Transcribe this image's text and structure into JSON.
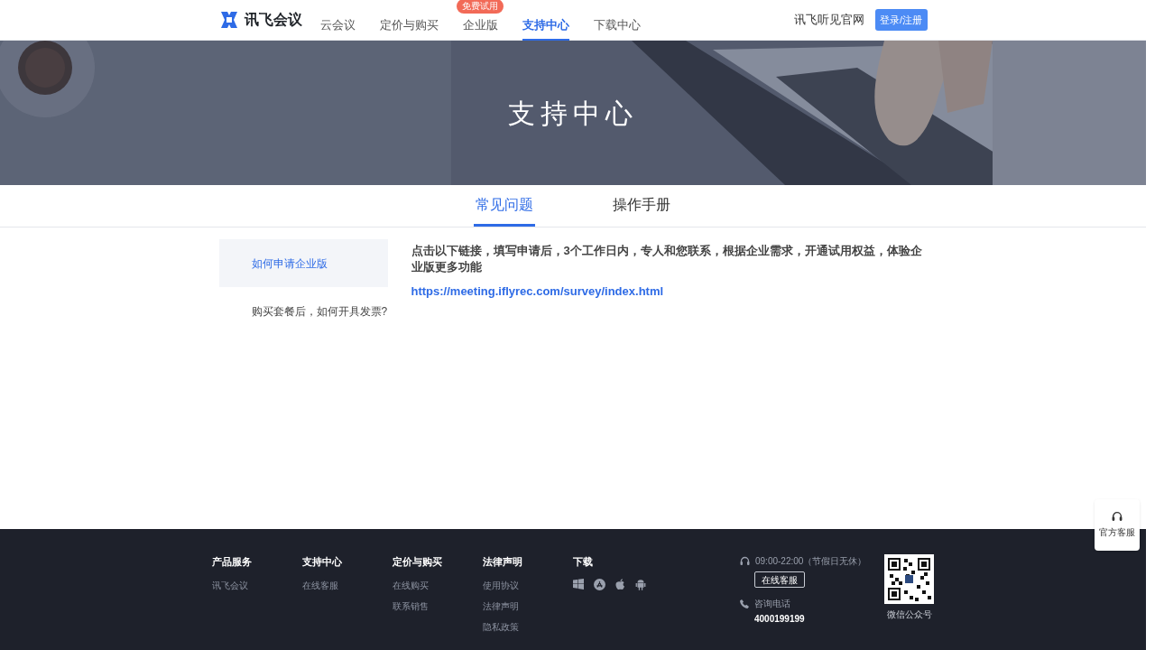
{
  "header": {
    "logo": "讯飞会议",
    "nav": [
      {
        "label": "云会议",
        "selected": false
      },
      {
        "label": "定价与购买",
        "selected": false
      },
      {
        "label": "企业版",
        "selected": false,
        "badge": "免费试用"
      },
      {
        "label": "支持中心",
        "selected": true
      },
      {
        "label": "下载中心",
        "selected": false
      }
    ],
    "site_link": "讯飞听见官网",
    "login_button": "登录/注册"
  },
  "hero": {
    "kind": "picture",
    "title": "支持中心"
  },
  "tabs": [
    {
      "label": "常见问题",
      "selected": true
    },
    {
      "label": "操作手册",
      "selected": false
    }
  ],
  "sidebar": {
    "items": [
      {
        "label": "如何申请企业版",
        "selected": true
      },
      {
        "label": "购买套餐后，如何开具发票?",
        "selected": false
      }
    ]
  },
  "article": {
    "text": "点击以下链接，填写申请后，3个工作日内，专人和您联系，根据企业需求，开通试用权益，体验企业版更多功能",
    "link": "https://meeting.iflyrec.com/survey/index.html"
  },
  "footer": {
    "columns": [
      {
        "title": "产品服务",
        "links": [
          "讯飞会议"
        ]
      },
      {
        "title": "支持中心",
        "links": [
          "在线客服"
        ]
      },
      {
        "title": "定价与购买",
        "links": [
          "在线购买",
          "联系销售"
        ]
      },
      {
        "title": "法律声明",
        "links": [
          "使用协议",
          "法律声明",
          "隐私政策"
        ]
      }
    ],
    "download": {
      "title": "下载",
      "platforms": [
        {
          "kind": "windows"
        },
        {
          "kind": "appstore"
        },
        {
          "kind": "apple"
        },
        {
          "kind": "android"
        }
      ]
    },
    "hours": "09:00-22:00（节假日无休）",
    "service_button": "在线客服",
    "phone_label": "咨询电话",
    "phone": "4000199199",
    "qr_caption": "微信公众号"
  },
  "float_widget": {
    "label": "官方客服"
  }
}
